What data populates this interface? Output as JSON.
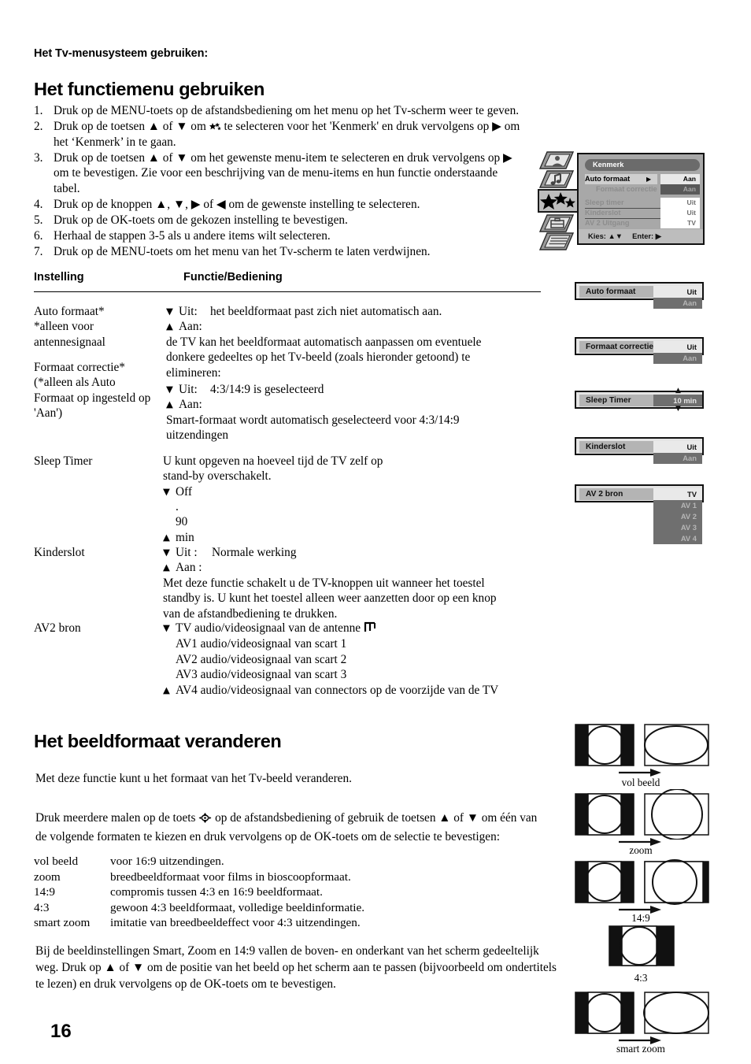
{
  "doc": {
    "kicker": "Het Tv-menusysteem gebruiken:",
    "page_number": "16"
  },
  "section1": {
    "heading": "Het functiemenu gebruiken",
    "steps": [
      {
        "num": "1.",
        "line1": "Druk op de MENU-toets op de afstandsbediening om het menu op het Tv-scherm weer te geven."
      },
      {
        "num": "2.",
        "line1": "Druk op de toetsen ▲ of ▼ om ",
        "line1b": " te selecteren voor het 'Kenmerk' en druk vervolgens op ▶ om",
        "line2": "het ‘Kenmerk’ in te gaan."
      },
      {
        "num": "3.",
        "line1": "Druk op de toetsen ▲ of ▼ om het gewenste menu-item te selecteren en druk vervolgens op ▶",
        "line2": "om te bevestigen.  Zie voor een beschrijving van de menu-items en hun functie onderstaande",
        "line3": "tabel."
      },
      {
        "num": "4.",
        "line1": "Druk op de knoppen ▲, ▼, ▶ of ◀ om de gewenste instelling te selecteren."
      },
      {
        "num": "5.",
        "line1": "Druk op de OK-toets om de gekozen instelling te bevestigen."
      },
      {
        "num": "6.",
        "line1": "Herhaal de stappen 3-5 als u andere items wilt selecteren."
      },
      {
        "num": "7.",
        "line1": "Druk op de MENU-toets om het menu van het Tv-scherm te laten verdwijnen."
      }
    ]
  },
  "table": {
    "headers": {
      "col1": "Instelling",
      "col2": "Functie/Bediening"
    },
    "rows": [
      {
        "setting": [
          "Auto formaat*",
          "*alleen voor",
          "antennesignaal"
        ],
        "options": [
          {
            "tri": "▼",
            "label": "Uit:",
            "text": "het beeldformaat past zich niet automatisch aan."
          },
          {
            "tri": "▲",
            "label": "Aan:",
            "text": "de TV kan het beeldformaat automatisch aanpassen om eventuele donkere gedeeltes op het Tv-beeld (zoals hieronder getoond) te elimineren:"
          }
        ]
      },
      {
        "setting": [
          "Formaat correctie*",
          "(*alleen als Auto",
          "Formaat op ingesteld op",
          "'Aan')"
        ],
        "options": [
          {
            "tri": "▼",
            "label": "Uit:",
            "text": "4:3/14:9 is geselecteerd"
          },
          {
            "tri": "▲",
            "label": "Aan:",
            "text": "Smart-formaat wordt automatisch geselecteerd voor 4:3/14:9 uitzendingen"
          }
        ]
      },
      {
        "setting": [
          "Sleep Timer"
        ],
        "intro": [
          "U kunt opgeven na hoeveel tijd de TV zelf op",
          "stand-by overschakelt."
        ],
        "options": [
          {
            "tri": "▼",
            "label": "Off",
            "text": ""
          },
          {
            "tri": "",
            "label": ".",
            "text": ""
          },
          {
            "tri": "▲",
            "label": "90 min",
            "text": ""
          }
        ]
      },
      {
        "setting": [
          "Kinderslot"
        ],
        "options": [
          {
            "tri": "▼",
            "label": "Uit :",
            "text": "Normale werking"
          },
          {
            "tri": "▲",
            "label": "Aan :",
            "text": "Met deze functie schakelt u de TV-knoppen uit wanneer het toestel standby is. U kunt het toestel alleen weer aanzetten door op een knop van de afstandbediening te drukken."
          }
        ]
      },
      {
        "setting": [
          "AV2 bron"
        ],
        "options": [
          {
            "tri": "▼",
            "label": "",
            "text": "TV audio/videosignaal van de antenne"
          },
          {
            "tri": "",
            "label": "",
            "text": "AV1 audio/videosignaal van scart 1"
          },
          {
            "tri": "",
            "label": "",
            "text": "AV2 audio/videosignaal van scart 2"
          },
          {
            "tri": "",
            "label": "",
            "text": "AV3 audio/videosignaal van scart 3"
          },
          {
            "tri": "▲",
            "label": "",
            "text": "AV4 audio/videosignaal van connectors op de voorzijde van de TV"
          }
        ]
      }
    ]
  },
  "section2": {
    "heading": "Het beeldformaat veranderen",
    "intro": "Met deze functie kunt u het formaat van het Tv-beeld veranderen.",
    "instruction_a": "Druk meerdere malen op de toets ",
    "instruction_b": " op de afstandsbediening of gebruik de toetsen ▲ of ▼ om één van",
    "instruction_c": "de volgende formaten te kiezen en druk vervolgens op de OK-toets om de selectie te bevestigen:",
    "formats": [
      {
        "name": "vol beeld",
        "desc": "voor 16:9 uitzendingen."
      },
      {
        "name": "zoom",
        "desc": "breedbeeldformaat voor films in bioscoopformaat."
      },
      {
        "name": "14:9",
        "desc": "compromis tussen 4:3 en 16:9 beeldformaat."
      },
      {
        "name": "4:3",
        "desc": "gewoon 4:3 beeldformaat, volledige beeldinformatie."
      },
      {
        "name": "smart zoom",
        "desc": "imitatie van breedbeeldeffect voor 4:3 uitzendingen."
      }
    ],
    "note_l1": "Bij de beeldinstellingen Smart, Zoom en 14:9 vallen de boven- en onderkant van het scherm gedeeltelijk",
    "note_l2": "weg. Druk op ▲ of ▼ om de positie van het beeld op het scherm aan te passen (bijvoorbeeld om ondertitels",
    "note_l3": "te lezen) en druk vervolgens op de OK-toets om te bevestigen."
  },
  "osd_menu": {
    "title": "Kenmerk",
    "rows": [
      {
        "name": "Auto formaat",
        "arrow": "▶",
        "value": "Aan",
        "state": "selected",
        "indent": false,
        "value_style": "light"
      },
      {
        "name": "Formaat correctie",
        "arrow": "",
        "value": "Aan",
        "state": "dim",
        "indent": true,
        "value_style": "dark"
      },
      {
        "name": "Sleep timer",
        "arrow": "",
        "value": "Uit",
        "state": "dim",
        "indent": false,
        "value_style": "white"
      },
      {
        "name": "Kinderslot",
        "arrow": "",
        "value": "Uit",
        "state": "dim",
        "indent": false,
        "value_style": "white"
      },
      {
        "name": "AV 2 Uitgang",
        "arrow": "",
        "value": "TV",
        "state": "dim",
        "indent": false,
        "value_style": "white"
      }
    ],
    "footer_kies": "Kies: ▲▼",
    "footer_enter": "Enter: ▶",
    "nav_icons": [
      "picture-icon",
      "sound-icon",
      "features-icon",
      "install-icon",
      "list-icon"
    ],
    "colors": {
      "panel": "#a8a8a8",
      "title_bar": "#6b6b6b",
      "footer": "#bdbdbd",
      "value_dark": "#595959"
    }
  },
  "osd_widgets": [
    {
      "label": "Auto formaat",
      "selected": "Uit",
      "options": [
        "Aan"
      ],
      "selected_dark": false,
      "has_updown": false
    },
    {
      "label": "Formaat correctie",
      "selected": "Uit",
      "options": [
        "Aan"
      ],
      "selected_dark": false,
      "has_updown": false
    },
    {
      "label": "Sleep Timer",
      "selected": "10 min",
      "options": [],
      "selected_dark": true,
      "has_updown": true
    },
    {
      "label": "Kinderslot",
      "selected": "Uit",
      "options": [
        "Aan"
      ],
      "selected_dark": false,
      "has_updown": false
    },
    {
      "label": "AV 2 bron",
      "selected": "TV",
      "options": [
        "AV 1",
        "AV 2",
        "AV 3",
        "AV 4"
      ],
      "selected_dark": false,
      "has_updown": false
    }
  ],
  "format_diagrams": [
    {
      "caption": "vol beeld",
      "left": "pillarbox-circle",
      "right": "wide-ellipse",
      "arrow": true
    },
    {
      "caption": "zoom",
      "left": "pillarbox-circle",
      "right": "oversized-circle",
      "arrow": true
    },
    {
      "caption": "14:9",
      "left": "pillarbox-circle",
      "right": "large-circle",
      "arrow": true
    },
    {
      "caption": "4:3",
      "left": "",
      "right": "pillarbox-circle",
      "arrow": false
    },
    {
      "caption": "smart zoom",
      "left": "pillarbox-circle",
      "right": "wide-ellipse",
      "arrow": true
    }
  ]
}
